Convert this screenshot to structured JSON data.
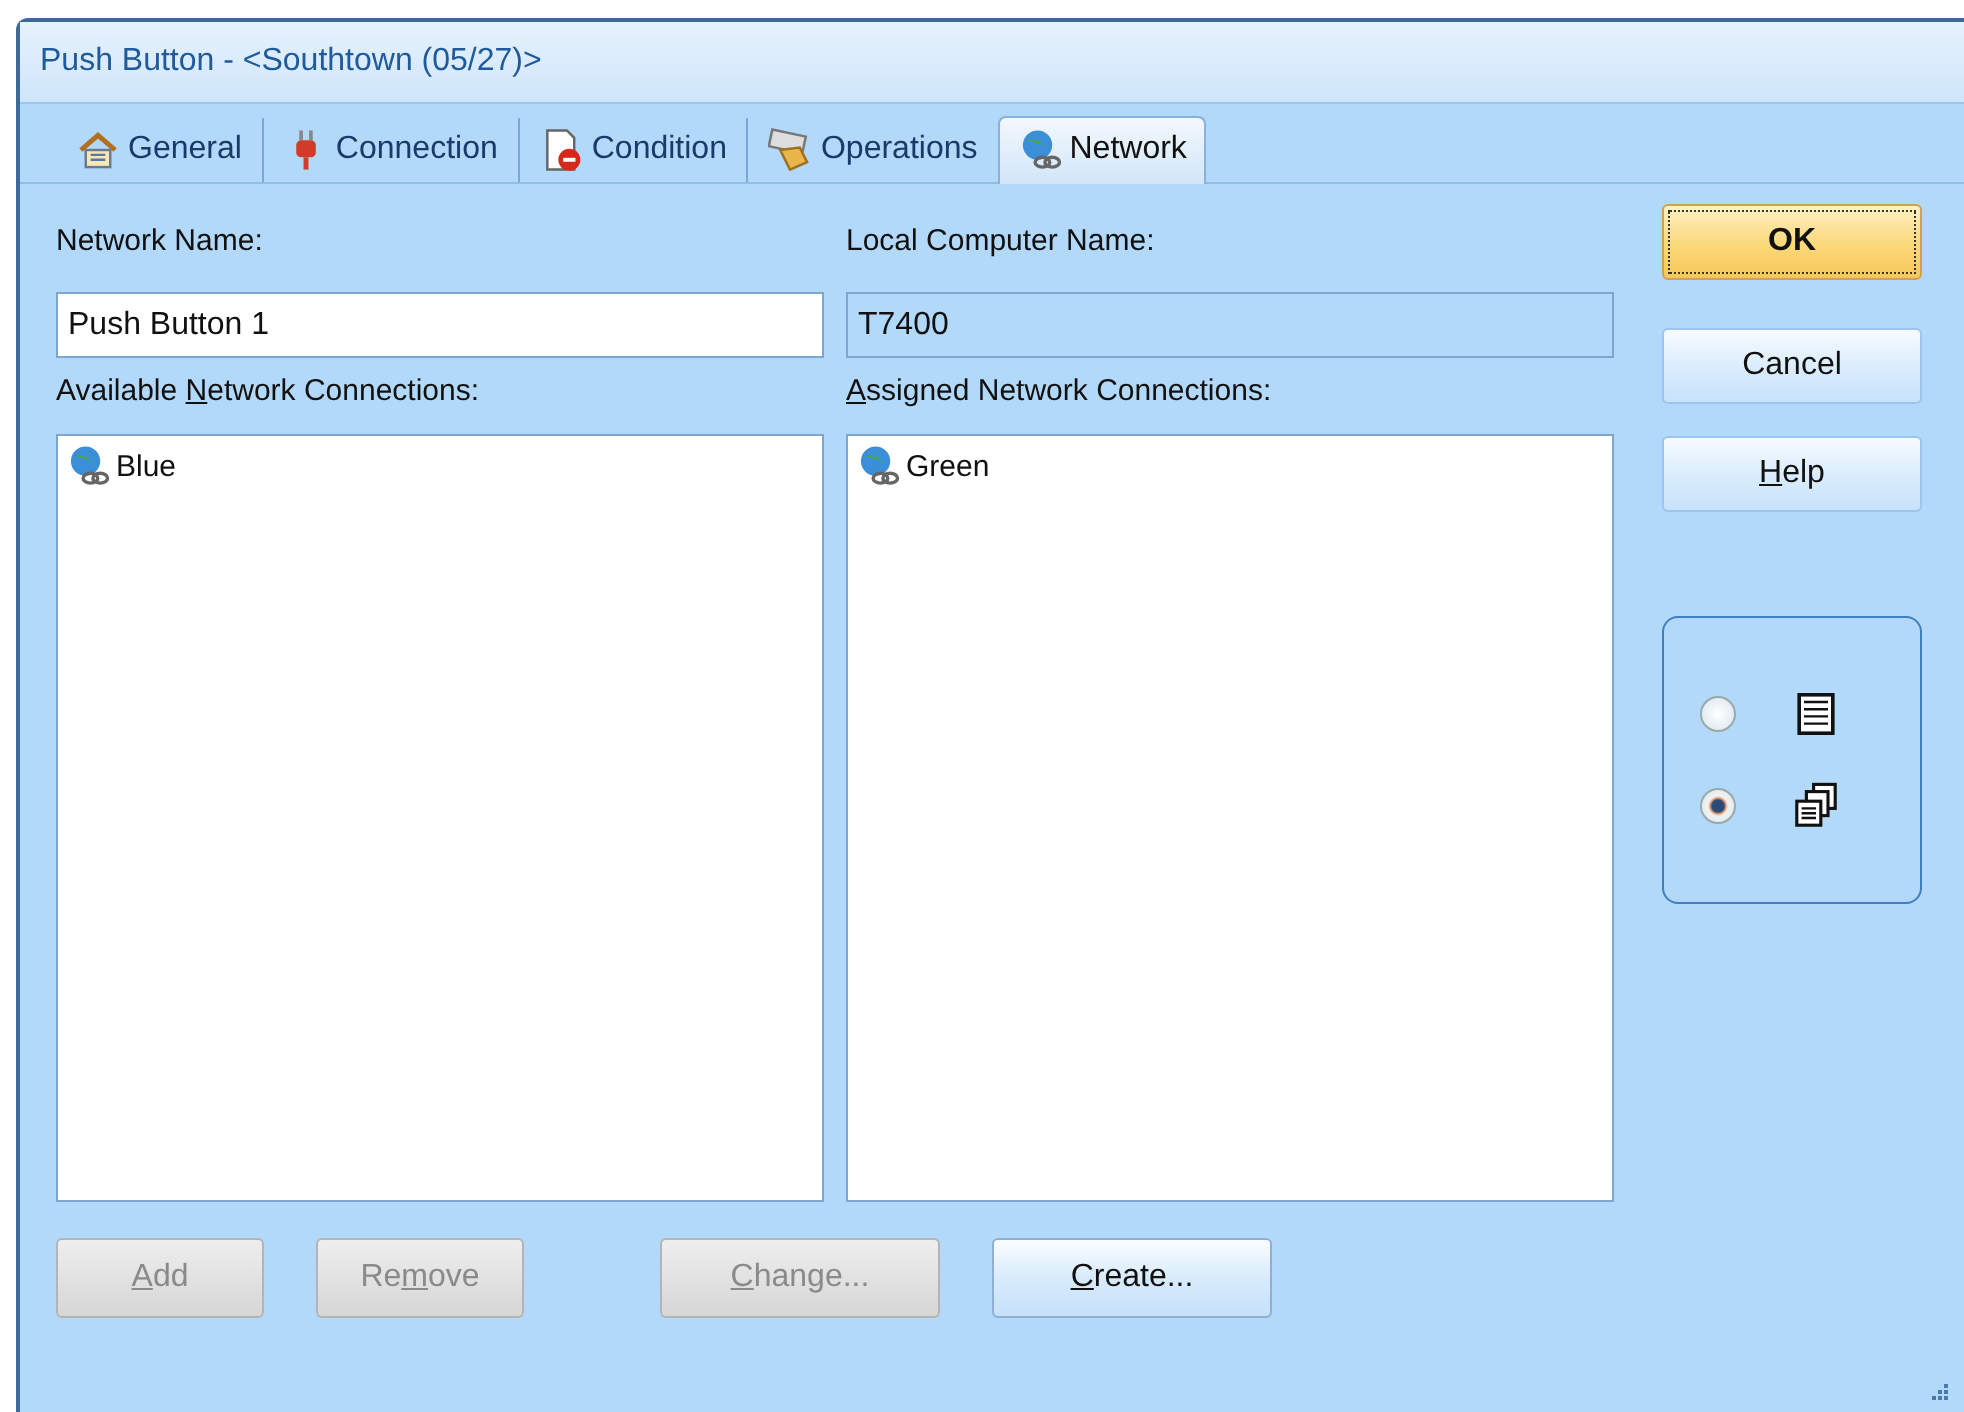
{
  "window": {
    "title": "Push Button - <Southtown (05/27)>"
  },
  "tabs": [
    {
      "label": "General",
      "selected": false
    },
    {
      "label": "Connection",
      "selected": false
    },
    {
      "label": "Condition",
      "selected": false
    },
    {
      "label": "Operations",
      "selected": false
    },
    {
      "label": "Network",
      "selected": true
    }
  ],
  "network_name": {
    "label": "Network Name:",
    "value": "Push Button 1"
  },
  "local_computer_name": {
    "label": "Local Computer Name:",
    "value": "T7400",
    "disabled": true
  },
  "available": {
    "label": {
      "before": "Available ",
      "key": "N",
      "after": "etwork Connections:"
    },
    "items": [
      {
        "label": "Blue"
      }
    ]
  },
  "assigned": {
    "label": {
      "key": "A",
      "after": "ssigned Network Connections:"
    },
    "items": [
      {
        "label": "Green"
      }
    ]
  },
  "list_buttons": [
    {
      "label": {
        "key": "A",
        "after": "dd"
      },
      "disabled": true
    },
    {
      "label": {
        "before": "Re",
        "key": "m",
        "after": "ove"
      },
      "disabled": true
    },
    {
      "label": {
        "key": "C",
        "after": "hange..."
      },
      "disabled": true
    },
    {
      "label": {
        "key": "C",
        "after": "reate..."
      },
      "disabled": false
    }
  ],
  "dialog_buttons": [
    {
      "label": {
        "after": "OK"
      },
      "kind": "default"
    },
    {
      "label": {
        "after": "Cancel"
      },
      "kind": "normal"
    },
    {
      "label": {
        "key": "H",
        "after": "elp"
      },
      "kind": "normal"
    }
  ],
  "view_options": [
    {
      "selected": false
    },
    {
      "selected": true
    }
  ]
}
